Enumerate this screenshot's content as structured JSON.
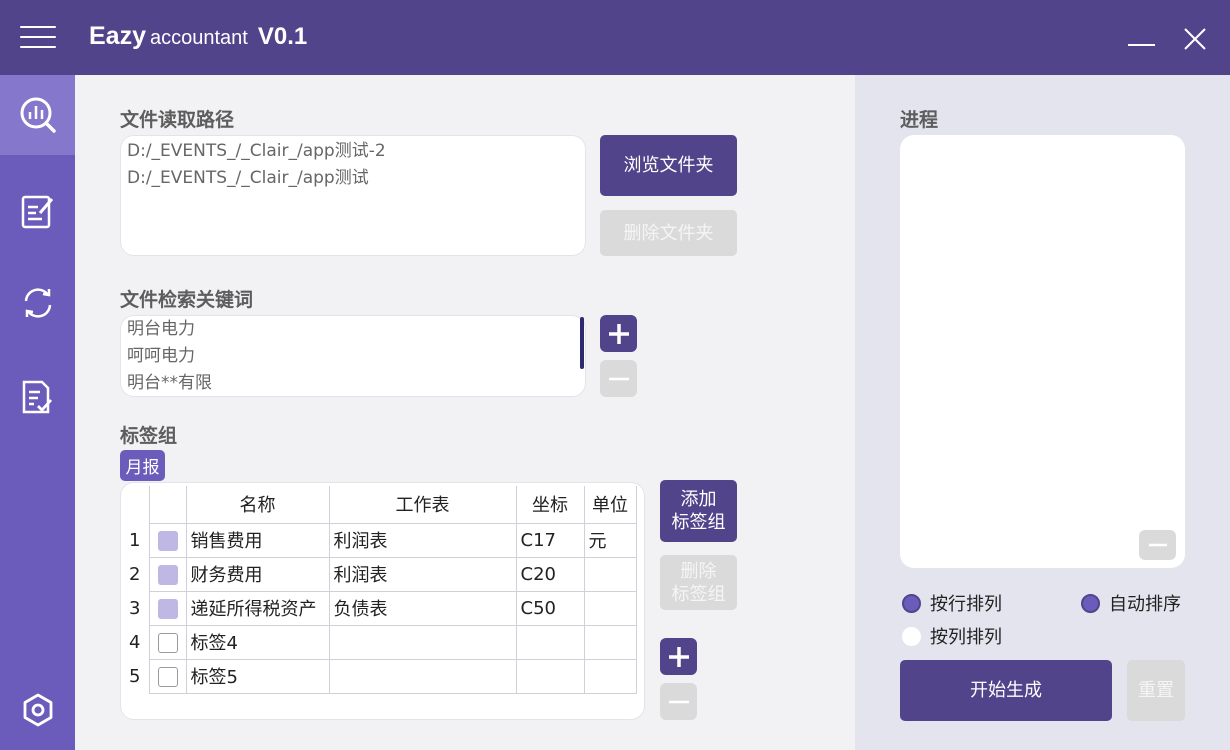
{
  "app": {
    "title_bold": "Eazy",
    "title_light": "accountant",
    "version": "V0.1"
  },
  "sidebar": {
    "items": [
      {
        "name": "analytics",
        "icon": "search-chart-icon",
        "active": true
      },
      {
        "name": "editor",
        "icon": "edit-document-icon",
        "active": false
      },
      {
        "name": "sync",
        "icon": "sync-icon",
        "active": false
      },
      {
        "name": "checklist",
        "icon": "checklist-document-icon",
        "active": false
      }
    ],
    "settings_icon": "settings-hexagon-icon"
  },
  "path_section": {
    "title": "文件读取路径",
    "paths": [
      "D:/_EVENTS_/_Clair_/app测试-2",
      "D:/_EVENTS_/_Clair_/app测试"
    ],
    "browse_label": "浏览文件夹",
    "delete_label": "删除文件夹"
  },
  "keyword_section": {
    "title": "文件检索关键词",
    "keywords": [
      "明台电力",
      "呵呵电力",
      "明台**有限"
    ]
  },
  "tag_section": {
    "title": "标签组",
    "active_group": "月报",
    "add_label": "添加\n标签组",
    "delete_label": "删除\n标签组",
    "columns": [
      "名称",
      "工作表",
      "坐标",
      "单位"
    ],
    "rows": [
      {
        "num": "1",
        "checked": true,
        "name": "销售费用",
        "sheet": "利润表",
        "coord": "C17",
        "unit": "元"
      },
      {
        "num": "2",
        "checked": true,
        "name": "财务费用",
        "sheet": "利润表",
        "coord": "C20",
        "unit": ""
      },
      {
        "num": "3",
        "checked": true,
        "name": "递延所得税资产",
        "sheet": "负债表",
        "coord": "C50",
        "unit": ""
      },
      {
        "num": "4",
        "checked": false,
        "name": "标签4",
        "sheet": "",
        "coord": "",
        "unit": ""
      },
      {
        "num": "5",
        "checked": false,
        "name": "标签5",
        "sheet": "",
        "coord": "",
        "unit": ""
      }
    ]
  },
  "progress_section": {
    "title": "进程",
    "options": {
      "by_row": "按行排列",
      "auto_sort": "自动排序",
      "by_column": "按列排列"
    },
    "start_label": "开始生成",
    "reset_label": "重置"
  },
  "colors": {
    "accent": "#51448b",
    "sidebar": "#6b5cbb",
    "checked": "#c0b8e4",
    "disabled": "#dadada"
  }
}
